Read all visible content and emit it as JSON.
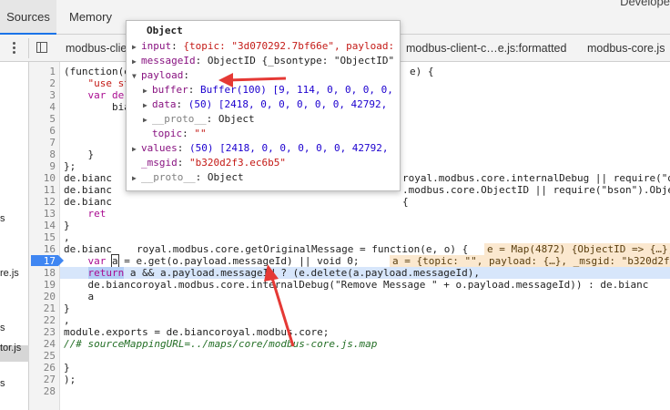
{
  "topbar": {
    "tabs": [
      "Sources",
      "Memory"
    ],
    "right_title": "Develope"
  },
  "filebar": {
    "files": [
      "modbus-clie",
      "modbus-client-c…e.js:formatted",
      "modbus-core.js"
    ]
  },
  "navigator": {
    "fragments": [
      "s",
      "re.js",
      "s",
      "tor.js",
      "s"
    ]
  },
  "gutter": {
    "lines": [
      "1",
      "2",
      "3",
      "4",
      "5",
      "6",
      "7",
      "8",
      "9",
      "10",
      "11",
      "12",
      "13",
      "14",
      "15",
      "16",
      "17",
      "18",
      "19",
      "20",
      "21",
      "22",
      "23",
      "24",
      "25",
      "26",
      "27",
      "28"
    ],
    "breakpoint_line": "17"
  },
  "code": {
    "l1": "(function(e",
    "l1b": "e) {",
    "l2": "    \"use st",
    "l3": "    var de",
    "l4": "        bia",
    "l8": "    }",
    "l9": "};",
    "l10": "de.bianc",
    "l10b": "royal.modbus.core.internalDebug || require(\"d",
    "l11": "de.bianc",
    "l11b": ".modbus.core.ObjectID || require(\"bson\").Obje",
    "l12": "de.bianc",
    "l12b": "{",
    "l13": "    ret",
    "l14": "}",
    "l15": ",",
    "l16": "de.bianc",
    "l16b": "royal.modbus.core.getOriginalMessage = function(e, o) {",
    "l16val": "e = Map(4872) {ObjectID => {…},",
    "l17a": "    var ",
    "l17var": "a",
    "l17b": " = e.get(o.payload.messageId) || void 0;",
    "l17val": "a = {topic: \"\", payload: {…}, _msgid: \"b320d2f",
    "l18a": "    ",
    "l18ret": "return",
    "l18b": " a && a.payload.messageId ? (e.delete(a.payload.messageId),",
    "l19": "    de.biancoroyal.modbus.core.internalDebug(\"Remove Message \" + o.payload.messageId)) : de.bianc",
    "l20": "    a",
    "l21": "}",
    "l22": ",",
    "l23": "module.exports = de.biancoroyal.modbus.core;",
    "l24": "//# sourceMappingURL=../maps/core/modbus-core.js.map",
    "l26": "}",
    "l27": ");"
  },
  "popover": {
    "title": "Object",
    "input_key": "input",
    "input_val": "{topic: \"3d070292.7bf66e\", payload:",
    "messageId_key": "messageId",
    "messageId_val": "ObjectID {_bsontype: \"ObjectID\"",
    "payload_key": "payload",
    "buffer_key": "buffer",
    "buffer_val": "Buffer(100) [9, 114, 0, 0, 0, 0,",
    "data_key": "data",
    "data_val": "(50) [2418, 0, 0, 0, 0, 0, 42792,",
    "proto_key": "__proto__",
    "proto_val": "Object",
    "topic_key": "topic",
    "topic_val": "\"\"",
    "values_key": "values",
    "values_val": "(50) [2418, 0, 0, 0, 0, 0, 42792,",
    "msgid_key": "_msgid",
    "msgid_val": "\"b320d2f3.ec6b5\"",
    "proto2_key": "__proto__",
    "proto2_val": "Object"
  },
  "colors": {
    "accent": "#1a73e8",
    "breakpoint": "#3f86f2",
    "annotation_arrow": "#e53935"
  }
}
